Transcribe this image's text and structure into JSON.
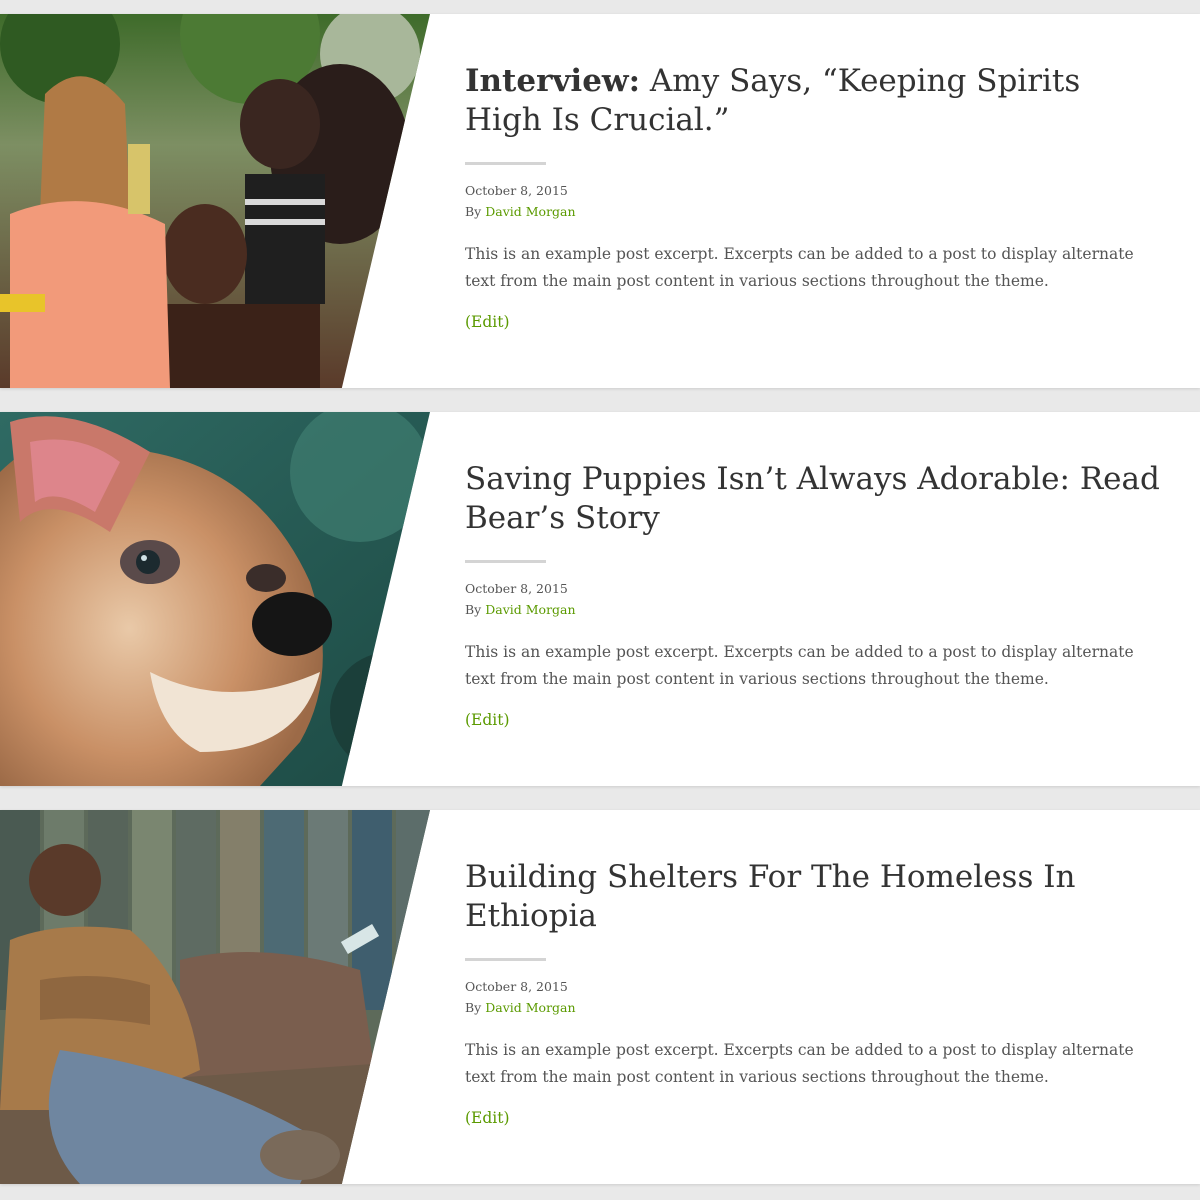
{
  "posts": [
    {
      "title_prefix": "Interview:",
      "title": " Amy Says, “Keeping Spirits High Is Crucial.”",
      "date": "October 8, 2015",
      "by_label": "By",
      "author": "David Morgan",
      "excerpt": "This is an example post excerpt. Excerpts can be added to a post to display alternate text from the main post content in various sections throughout the theme.",
      "edit_label": "(Edit)",
      "image_subject": "woman-with-children-photo"
    },
    {
      "title": "Saving Puppies Isn’t Always Adorable: Read Bear’s Story",
      "date": "October 8, 2015",
      "by_label": "By",
      "author": "David Morgan",
      "excerpt": "This is an example post excerpt. Excerpts can be added to a post to display alternate text from the main post content in various sections throughout the theme.",
      "edit_label": "(Edit)",
      "image_subject": "puppy-photo"
    },
    {
      "title": "Building Shelters For The Homeless In Ethiopia",
      "date": "October 8, 2015",
      "by_label": "By",
      "author": "David Morgan",
      "excerpt": "This is an example post excerpt. Excerpts can be added to a post to display alternate text from the main post content in various sections throughout the theme.",
      "edit_label": "(Edit)",
      "image_subject": "man-resting-by-fence-photo"
    }
  ],
  "colors": {
    "link": "#5b9a00",
    "title": "#333333",
    "text": "#555555",
    "page_background": "#e9e9e9"
  }
}
